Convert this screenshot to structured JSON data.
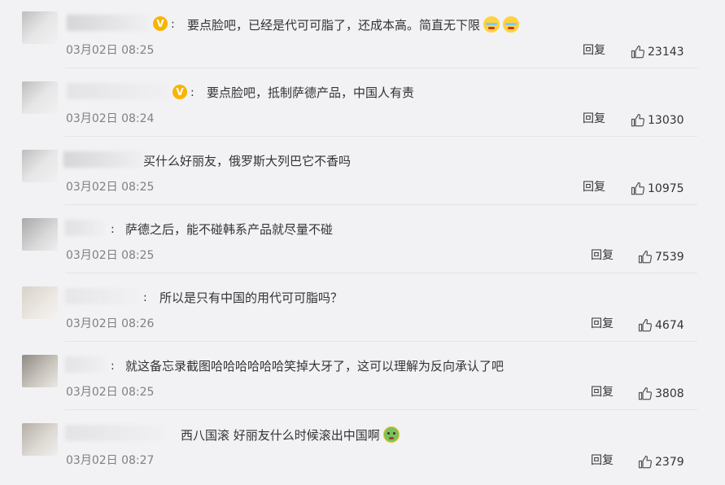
{
  "labels": {
    "reply": "回复"
  },
  "comments": [
    {
      "text": "要点脸吧，已经是代可可脂了，还成本高。简直无下限",
      "time": "03月02日 08:25",
      "likes": "23143",
      "verified": true,
      "emojis": [
        "cry-emoji",
        "cry-emoji"
      ]
    },
    {
      "text": "要点脸吧，抵制萨德产品，中国人有责",
      "time": "03月02日 08:24",
      "likes": "13030",
      "verified": true,
      "emojis": []
    },
    {
      "text": "买什么好丽友，俄罗斯大列巴它不香吗",
      "time": "03月02日 08:25",
      "likes": "10975",
      "verified": false,
      "emojis": []
    },
    {
      "text": "萨德之后，能不碰韩系产品就尽量不碰",
      "time": "03月02日 08:25",
      "likes": "7539",
      "verified": false,
      "emojis": []
    },
    {
      "text": "所以是只有中国的用代可可脂吗？",
      "time": "03月02日 08:26",
      "likes": "4674",
      "verified": false,
      "emojis": []
    },
    {
      "text": "就这备忘录截图哈哈哈哈哈哈笑掉大牙了，这可以理解为反向承认了吧",
      "time": "03月02日 08:25",
      "likes": "3808",
      "verified": false,
      "emojis": []
    },
    {
      "text": "西八国滚 好丽友什么时候滚出中国啊",
      "time": "03月02日 08:27",
      "likes": "2379",
      "verified": false,
      "emojis": [
        "sick-emoji"
      ]
    }
  ]
}
